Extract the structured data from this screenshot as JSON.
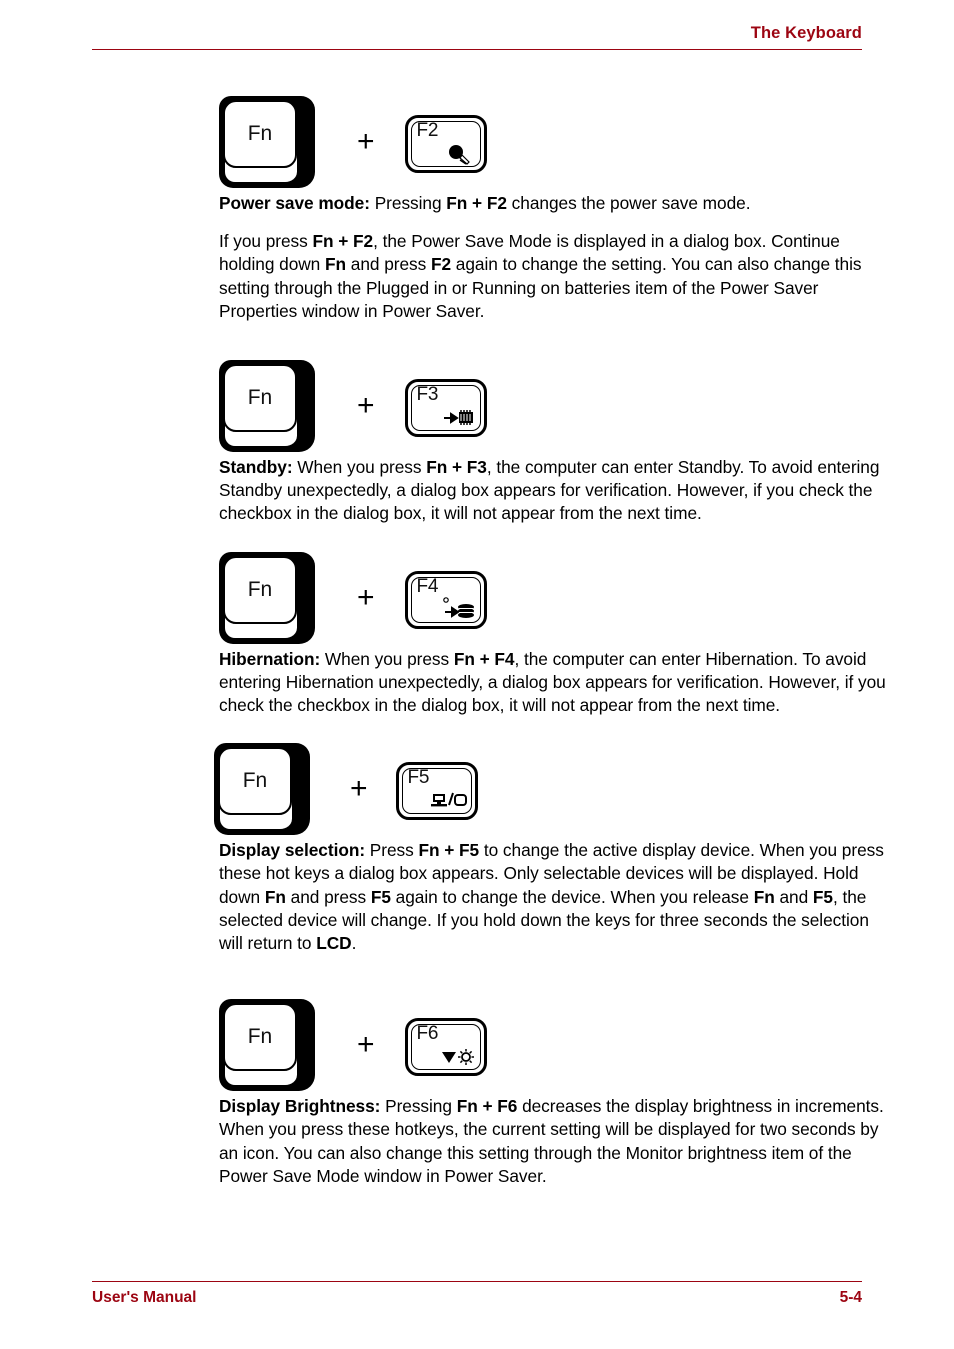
{
  "header": {
    "title": "The Keyboard",
    "rule_color": "#9c0512"
  },
  "footer": {
    "left_label": "User's Manual",
    "page_number": "5-4",
    "rule_color": "#9c0512"
  },
  "modifier_key": {
    "label": "Fn",
    "name": "fn-key"
  },
  "plus": "+",
  "hotkeys": [
    {
      "function_key": "F2",
      "icon": "power-save-icon",
      "heading": "Power save mode:",
      "intro_text_1": " Pressing ",
      "intro_bold": "Fn + F2",
      "intro_text_2": " changes the power save mode.",
      "body_segments": [
        {
          "text": "If you press ",
          "bold": false
        },
        {
          "text": "Fn + F2",
          "bold": true
        },
        {
          "text": ", the Power Save Mode is displayed in a dialog box. Continue holding down ",
          "bold": false
        },
        {
          "text": "Fn",
          "bold": true
        },
        {
          "text": " and press ",
          "bold": false
        },
        {
          "text": "F2",
          "bold": true
        },
        {
          "text": " again to change the setting. You can also change this setting through the Plugged in or Running on batteries item of the Power Saver Properties window in Power Saver.",
          "bold": false
        }
      ]
    },
    {
      "function_key": "F3",
      "icon": "standby-chip-icon",
      "heading": "Standby:",
      "body_segments": [
        {
          "text": "Standby:",
          "bold": true
        },
        {
          "text": " When you press ",
          "bold": false
        },
        {
          "text": "Fn + F3",
          "bold": true
        },
        {
          "text": ", the computer can enter Standby. To avoid entering Standby unexpectedly, a dialog box appears for verification. However, if you check the checkbox in the dialog box, it will not appear from the next time.",
          "bold": false
        }
      ]
    },
    {
      "function_key": "F4",
      "icon": "hibernation-disk-icon",
      "heading": "Hibernation:",
      "body_segments": [
        {
          "text": "Hibernation:",
          "bold": true
        },
        {
          "text": " When you press ",
          "bold": false
        },
        {
          "text": "Fn + F4",
          "bold": true
        },
        {
          "text": ", the computer can enter Hibernation. To avoid entering Hibernation unexpectedly, a dialog box appears for verification. However, if you check the checkbox in the dialog box, it will not appear from the next time.",
          "bold": false
        }
      ]
    },
    {
      "function_key": "F5",
      "icon": "display-selection-icon",
      "heading": "Display selection:",
      "body_segments": [
        {
          "text": "Display selection:",
          "bold": true
        },
        {
          "text": " Press ",
          "bold": false
        },
        {
          "text": "Fn + F5",
          "bold": true
        },
        {
          "text": " to change the active display device. When you press these hot keys a dialog box appears. Only selectable devices will be displayed. Hold down ",
          "bold": false
        },
        {
          "text": "Fn",
          "bold": true
        },
        {
          "text": " and press ",
          "bold": false
        },
        {
          "text": "F5",
          "bold": true
        },
        {
          "text": " again to change the device. When you release ",
          "bold": false
        },
        {
          "text": "Fn",
          "bold": true
        },
        {
          "text": " and ",
          "bold": false
        },
        {
          "text": "F5",
          "bold": true
        },
        {
          "text": ", the selected device will change. If you hold down the keys for three seconds the selection will return to ",
          "bold": false
        },
        {
          "text": "LCD",
          "bold": true
        },
        {
          "text": ".",
          "bold": false
        }
      ]
    },
    {
      "function_key": "F6",
      "icon": "brightness-down-icon",
      "heading": "Display Brightness:",
      "body_segments": [
        {
          "text": "Display Brightness:",
          "bold": true
        },
        {
          "text": " Pressing ",
          "bold": false
        },
        {
          "text": "Fn + F6",
          "bold": true
        },
        {
          "text": " decreases the display brightness in increments. When you press these hotkeys, the current setting will be displayed for two seconds by an icon. You can also change this setting through the Monitor brightness item of the Power Save Mode window in Power Saver.",
          "bold": false
        }
      ]
    }
  ],
  "paragraph_1_segments": [
    {
      "text": "Power save mode:",
      "bold": true
    },
    {
      "text": " Pressing ",
      "bold": false
    },
    {
      "text": "Fn + F2",
      "bold": true
    },
    {
      "text": " changes the power save mode.",
      "bold": false
    }
  ]
}
